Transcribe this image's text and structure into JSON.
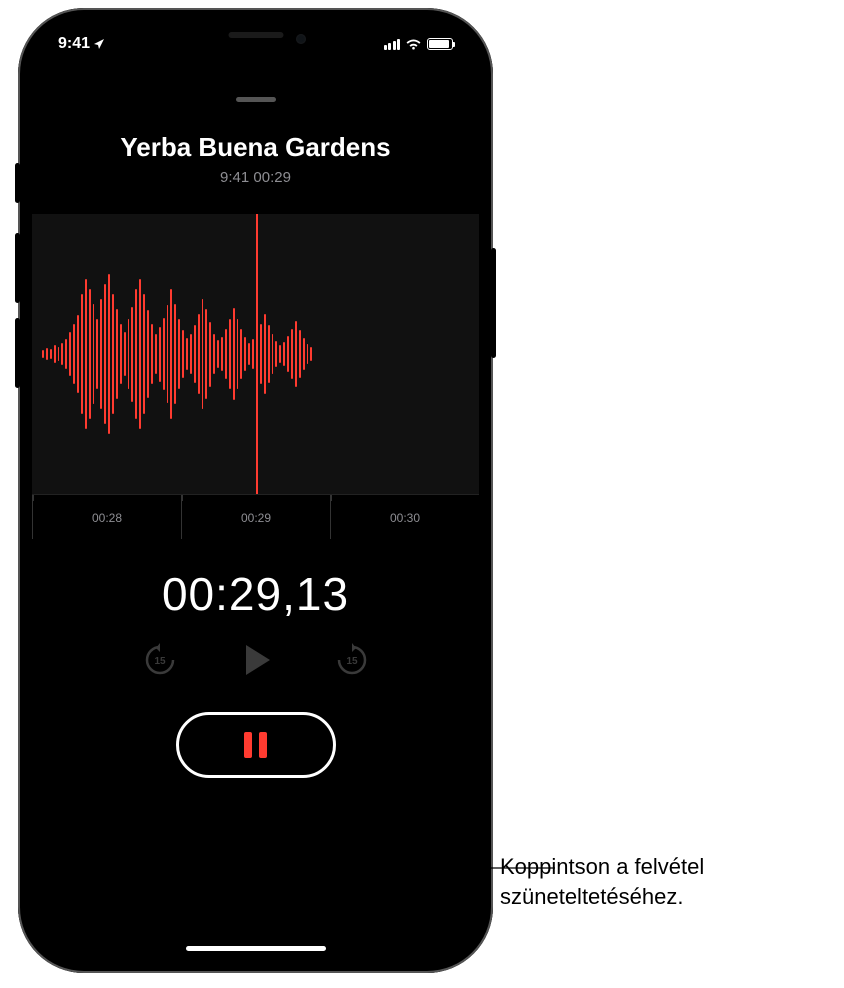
{
  "statusbar": {
    "time": "9:41",
    "location_icon": "location-arrow"
  },
  "recording": {
    "title": "Yerba Buena Gardens",
    "subtitle": "9:41   00:29",
    "timeline_labels": [
      "00:28",
      "00:29",
      "00:30"
    ],
    "elapsed_display": "00:29,13",
    "skip_back_seconds": "15",
    "skip_forward_seconds": "15"
  },
  "callout": {
    "text": "Koppintson a felvétel szüneteltetéséhez."
  }
}
